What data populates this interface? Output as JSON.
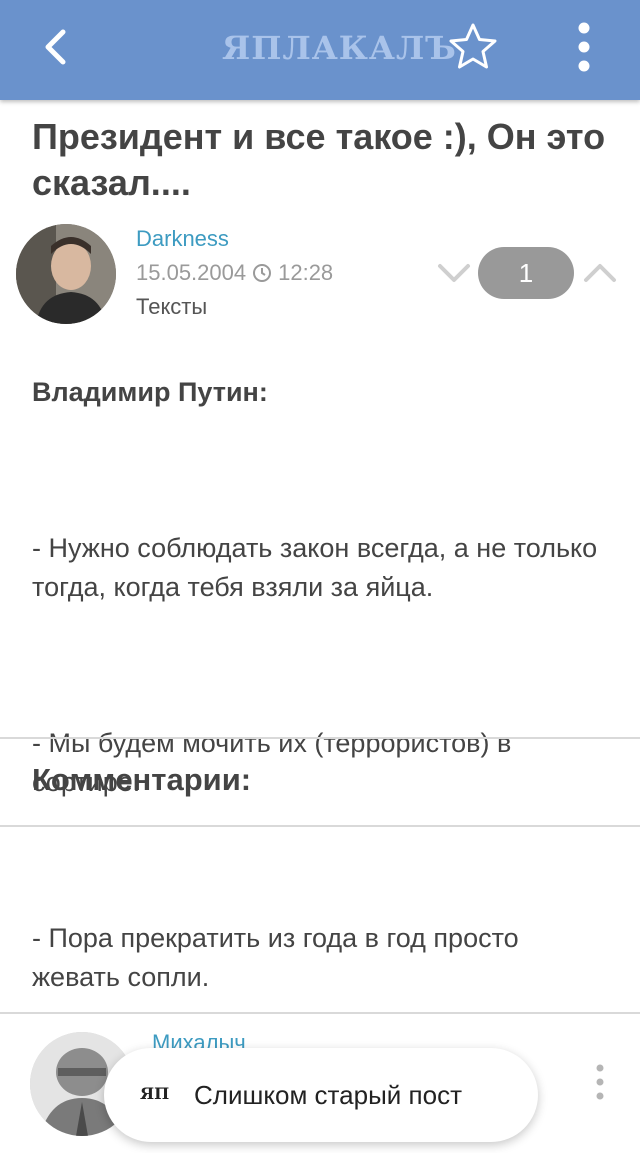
{
  "appbar": {
    "logo_text": "ЯПЛАКАЛЪ",
    "bg_color": "#6a92cc",
    "icons": [
      "back-arrow-icon",
      "star-icon",
      "more-vertical-icon"
    ]
  },
  "post": {
    "title": "Президент и все такое :), Он это сказал....",
    "author": "Darkness",
    "date": "15.05.2004",
    "time": "12:28",
    "category": "Тексты",
    "rating": "1",
    "body_speaker": "Владимир Путин:",
    "body_lines": [
      "- Нужно соблюдать закон всегда, а не только тогда, когда тебя взяли за яйца.",
      "- Мы будем мочить их (террористов) в сортире.",
      "- Пора прекратить из года в год просто жевать сопли."
    ]
  },
  "comments": {
    "heading": "Комментарии:",
    "first_author": "Михалыч"
  },
  "toast": {
    "logo": "ЯП",
    "text": "Слишком старый пост"
  },
  "colors": {
    "link": "#3d9bc1",
    "rating_bg": "#999999"
  }
}
